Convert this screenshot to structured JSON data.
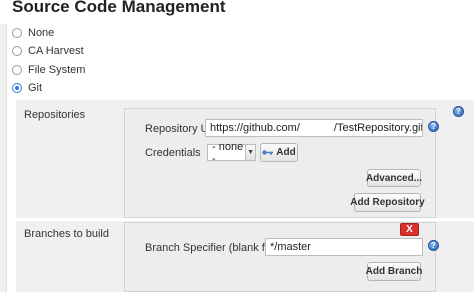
{
  "section": {
    "title": "Source Code Management"
  },
  "scm_options": [
    {
      "label": "None",
      "selected": false
    },
    {
      "label": "CA Harvest",
      "selected": false
    },
    {
      "label": "File System",
      "selected": false
    },
    {
      "label": "Git",
      "selected": true
    }
  ],
  "repositories": {
    "label": "Repositories",
    "url_label": "Repository URL",
    "url_value_start": "https://github.com/",
    "url_value_end": "/TestRepository.git",
    "credentials_label": "Credentials",
    "credentials_value": "- none -",
    "add_label": "Add",
    "advanced_label": "Advanced...",
    "add_repository_label": "Add Repository"
  },
  "branches": {
    "label": "Branches to build",
    "specifier_label": "Branch Specifier (blank for 'any')",
    "specifier_value": "*/master",
    "delete_label": "X",
    "add_branch_label": "Add Branch"
  },
  "help_symbol": "?",
  "icons": {
    "radio": "radio-button",
    "help": "help-icon",
    "key": "key-icon",
    "dropdown": "chevron-down-icon",
    "delete": "close-icon"
  },
  "colors": {
    "accent": "#2a7ad2",
    "delete": "#d9302b",
    "panel": "#ededed"
  }
}
